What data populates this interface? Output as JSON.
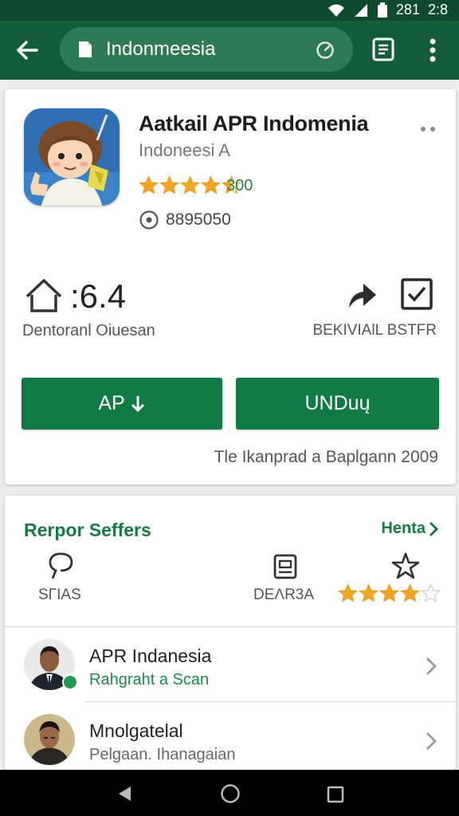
{
  "status_bar": {
    "time": "2:8",
    "date_prefix": "281"
  },
  "browser": {
    "url_text": "Indonmeesia"
  },
  "app": {
    "title": "Aatkail APR Indomenia",
    "developer": "Indoneesi A",
    "rating_stars": 4.5,
    "rating_count": "300",
    "downloads": "8895050",
    "rating_value": ":6.4",
    "rating_label": "Dentoranl Oiuesan",
    "share_label": "BEKIVIAlL BSTFR",
    "buttons": {
      "ap": "AP",
      "unduh": "UNDuų"
    },
    "release_text": "Tle  Ikanprad a Baplgann 2009",
    "accent_color": "#117a43"
  },
  "sellers": {
    "title": "Rerpor Seffers",
    "more": "Henta",
    "categories": [
      {
        "label": "SΓΙAS",
        "icon": "bubble-icon"
      },
      {
        "label": "DEΛR3A",
        "icon": "document-icon"
      },
      {
        "icon": "star-badge-icon",
        "rating_stars": 4
      }
    ],
    "list": [
      {
        "name": "APR Indanesia",
        "subtitle": "Rahgraht a Scan",
        "verified": true
      },
      {
        "name": "Mnolgatelal",
        "subtitle": "Pelgaan. Ihanagaian",
        "verified": false
      }
    ]
  }
}
